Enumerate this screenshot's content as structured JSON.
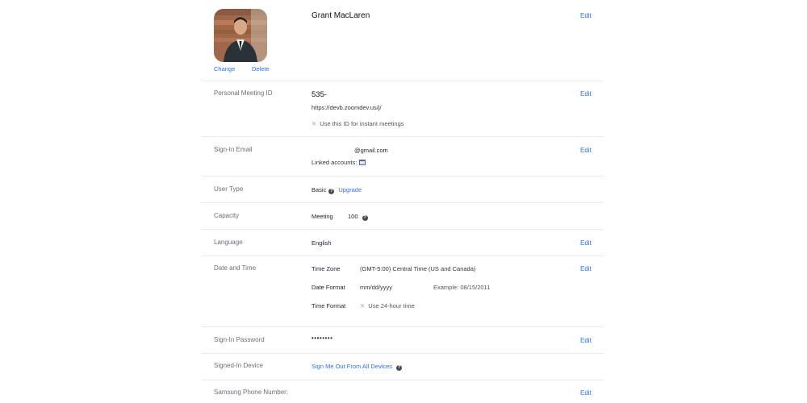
{
  "profile": {
    "name": "Grant MacLaren",
    "photo_change": "Change",
    "photo_delete": "Delete",
    "edit": "Edit"
  },
  "pmi": {
    "label": "Personal Meeting ID",
    "id": "535-",
    "url": "https://devb.zoomdev.us/j/",
    "instant_option": "Use this ID for instant meetings"
  },
  "email": {
    "label": "Sign-In Email",
    "value": "@gmail.com",
    "linked_label": "Linked accounts:",
    "linked_icon": "calendar-icon"
  },
  "user_type": {
    "label": "User Type",
    "value": "Basic",
    "upgrade": "Upgrade"
  },
  "capacity": {
    "label": "Capacity",
    "meeting_label": "Meeting",
    "meeting_value": "100"
  },
  "language": {
    "label": "Language",
    "value": "English"
  },
  "datetime": {
    "label": "Date and Time",
    "tz_label": "Time Zone",
    "tz_value": "(GMT-5:00) Central Time (US and Canada)",
    "df_label": "Date Format",
    "df_value": "mm/dd/yyyy",
    "df_example": "Example: 08/15/2011",
    "tf_label": "Time Format",
    "tf_value": "Use 24-hour time"
  },
  "password": {
    "label": "Sign-In Password",
    "value": "••••••••"
  },
  "devices": {
    "label": "Signed-In Device",
    "signout": "Sign Me Out From All Devices"
  },
  "phone": {
    "label": "Samsung Phone Number:"
  },
  "colors": {
    "link": "#2d6ff0",
    "divider": "#e9e9ee",
    "label": "#6e6e7e"
  }
}
